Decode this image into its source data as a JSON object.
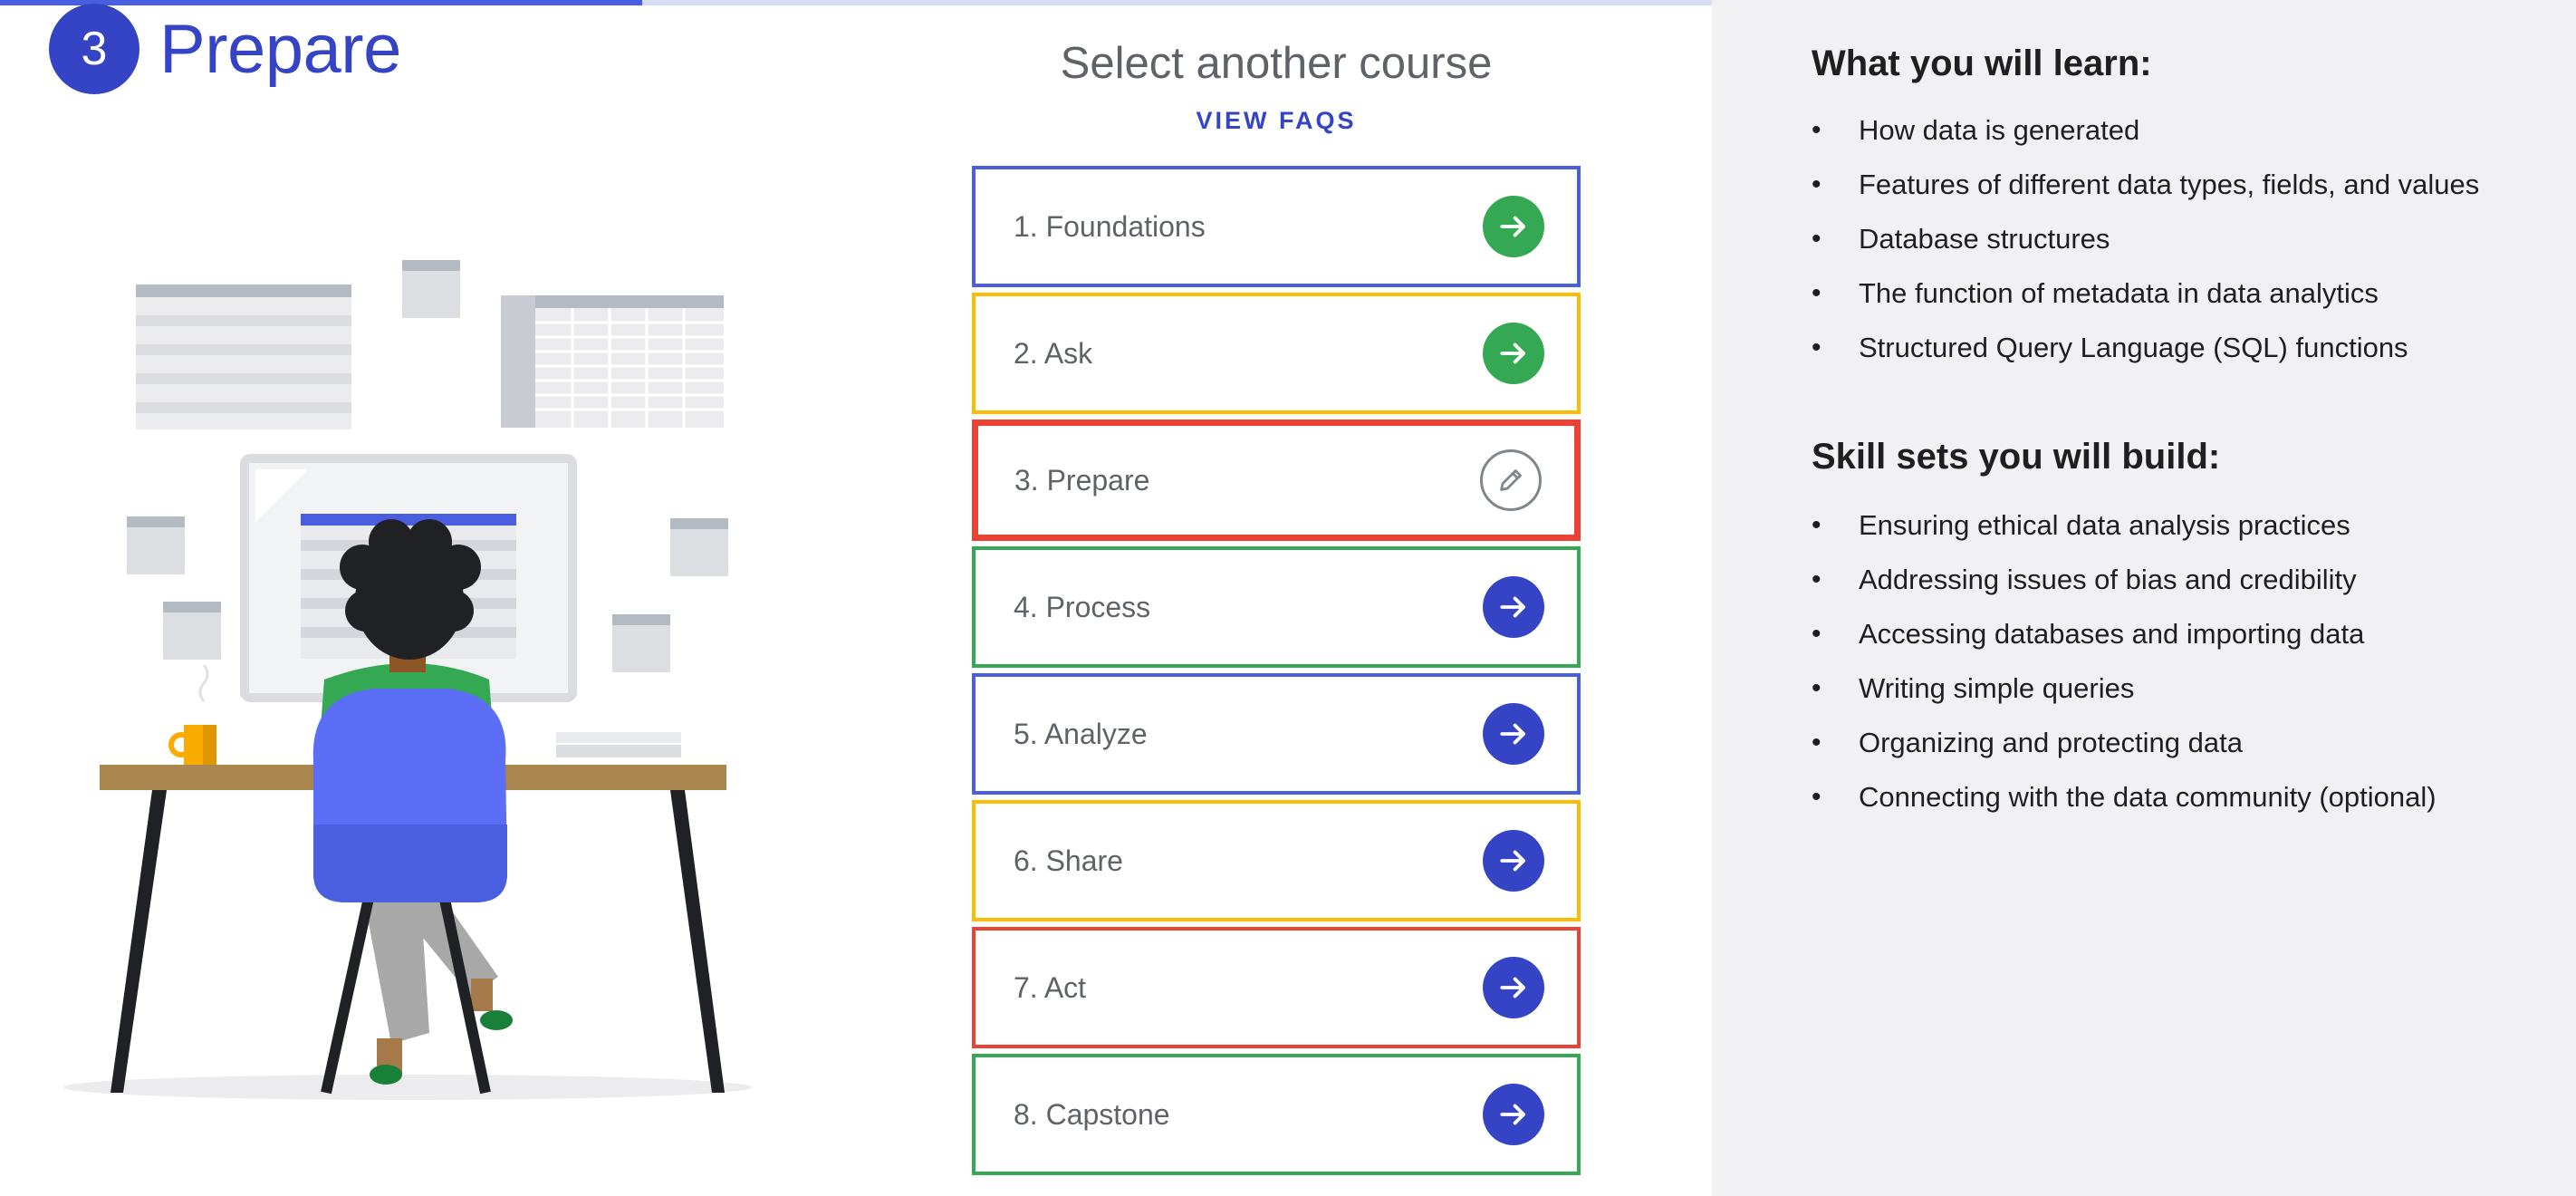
{
  "progress": {
    "fraction": 0.375,
    "fill_color": "#4a5ee0",
    "track_color": "#d8dcf4"
  },
  "module": {
    "number": "3",
    "title": "Prepare",
    "accent_color": "#3544c4"
  },
  "course_list": {
    "title": "Select another course",
    "faq_link": "VIEW FAQS",
    "courses": [
      {
        "label": "1. Foundations",
        "border_color": "#4a5ee0",
        "action": "arrow-right-icon",
        "action_color": "#34a853",
        "current": false
      },
      {
        "label": "2. Ask",
        "border_color": "#fbbc04",
        "action": "arrow-right-icon",
        "action_color": "#34a853",
        "current": false
      },
      {
        "label": "3. Prepare",
        "border_color": "#ea4335",
        "action": "pencil-icon",
        "action_color": "#80868b",
        "current": true
      },
      {
        "label": "4. Process",
        "border_color": "#34a853",
        "action": "arrow-right-icon",
        "action_color": "#3544c4",
        "current": false
      },
      {
        "label": "5. Analyze",
        "border_color": "#4a5ee0",
        "action": "arrow-right-icon",
        "action_color": "#3544c4",
        "current": false
      },
      {
        "label": "6. Share",
        "border_color": "#fbbc04",
        "action": "arrow-right-icon",
        "action_color": "#3544c4",
        "current": false
      },
      {
        "label": "7. Act",
        "border_color": "#ea4335",
        "action": "arrow-right-icon",
        "action_color": "#3544c4",
        "current": false
      },
      {
        "label": "8. Capstone",
        "border_color": "#34a853",
        "action": "arrow-right-icon",
        "action_color": "#3544c4",
        "current": false
      }
    ]
  },
  "learn": {
    "heading": "What you will learn:",
    "items": [
      "How data is generated",
      "Features of different data types, fields, and values",
      "Database structures",
      "The function of metadata in data analytics",
      "Structured Query Language (SQL) functions"
    ]
  },
  "skills": {
    "heading": "Skill sets you will build:",
    "items": [
      "Ensuring ethical data analysis practices",
      "Addressing issues of bias and credibility",
      "Accessing databases and importing data",
      "Writing simple queries",
      "Organizing and protecting data",
      "Connecting with the data community (optional)"
    ]
  }
}
